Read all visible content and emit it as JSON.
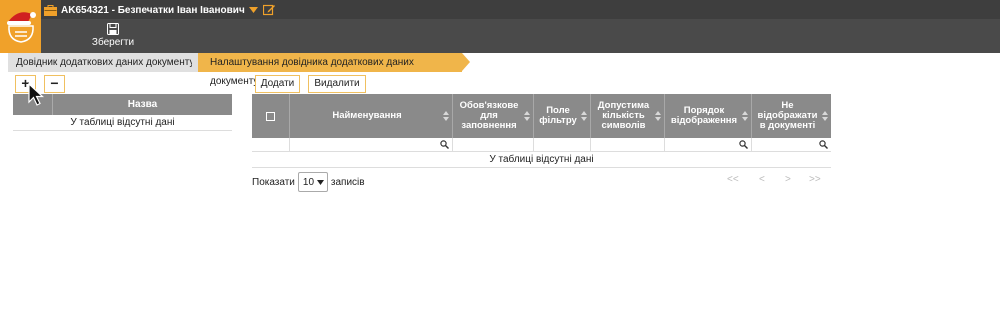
{
  "header": {
    "account": "AK654321 - Безпечатки Іван Іванович",
    "save_label": "Зберегти"
  },
  "breadcrumb": {
    "items": [
      "Довідник додаткових даних документу",
      "Налаштування довідника додаткових даних документу"
    ]
  },
  "left_panel": {
    "add_label": "+",
    "remove_label": "−",
    "column_header": "Назва",
    "empty_text": "У таблиці відсутні дані"
  },
  "right_panel": {
    "add_label": "Додати",
    "delete_label": "Видалити",
    "columns": [
      "Найменування",
      "Обов'язкове для заповнення",
      "Поле фільтру",
      "Допустима кількість символів",
      "Порядок відображення",
      "Не відображати в документі"
    ],
    "empty_text": "У таблиці відсутні дані",
    "show_label": "Показати",
    "page_size": "10",
    "records_label": "записів",
    "nav": [
      "<<",
      "<",
      ">",
      ">>"
    ]
  },
  "colors": {
    "topbar": "#4a4a4a",
    "accent": "#f0a12a",
    "table_header": "#8a8a8a"
  }
}
